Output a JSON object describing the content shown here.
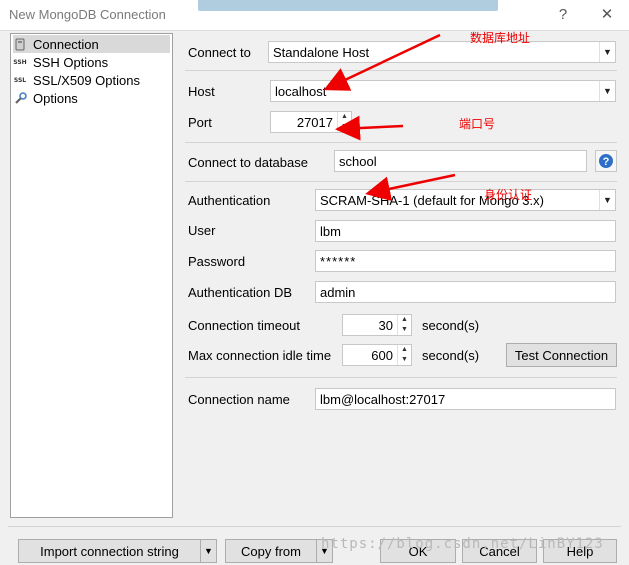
{
  "window": {
    "title": "New MongoDB Connection",
    "help_glyph": "?",
    "close_glyph": "✕"
  },
  "sidebar": {
    "items": [
      {
        "label": "Connection",
        "icon": "connection-icon"
      },
      {
        "label": "SSH Options",
        "icon": "ssh-icon",
        "icon_text": "SSH"
      },
      {
        "label": "SSL/X509 Options",
        "icon": "ssl-icon",
        "icon_text": "SSL"
      },
      {
        "label": "Options",
        "icon": "wrench-icon"
      }
    ]
  },
  "form": {
    "connect_to_label": "Connect to",
    "connect_to_value": "Standalone Host",
    "host_label": "Host",
    "host_value": "localhost",
    "port_label": "Port",
    "port_value": "27017",
    "database_label": "Connect to database",
    "database_value": "school",
    "auth_label": "Authentication",
    "auth_value": "SCRAM-SHA-1 (default for Mongo 3.x)",
    "user_label": "User",
    "user_value": "lbm",
    "password_label": "Password",
    "password_value": "******",
    "authdb_label": "Authentication DB",
    "authdb_value": "admin",
    "conn_timeout_label": "Connection timeout",
    "conn_timeout_value": "30",
    "conn_timeout_unit": "second(s)",
    "idle_label": "Max connection idle time",
    "idle_value": "600",
    "idle_unit": "second(s)",
    "test_button": "Test Connection",
    "name_label": "Connection name",
    "name_value": "lbm@localhost:27017"
  },
  "annotations": {
    "db_address": "数据库地址",
    "port": "端口号",
    "auth": "身份认证"
  },
  "footer": {
    "import_button": "Import connection string",
    "copy_button": "Copy from",
    "ok_button": "OK",
    "cancel_button": "Cancel",
    "help_button": "Help"
  },
  "watermark": "https://blog.csdn.net/LinBY123",
  "colors": {
    "annotation": "#ee0000",
    "selection": "#d9d9d9",
    "info_button": "#2f6fc7"
  }
}
